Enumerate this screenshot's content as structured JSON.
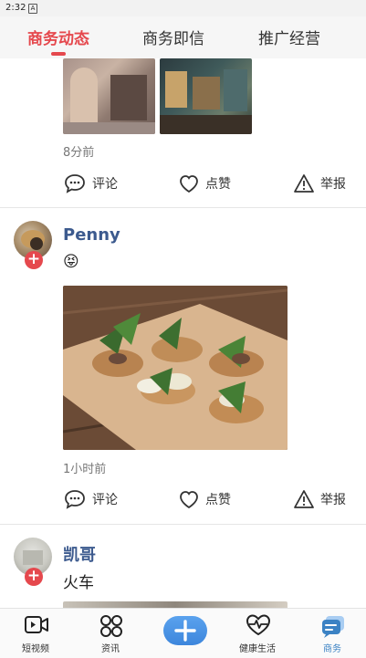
{
  "status_bar": {
    "time": "2:32",
    "notification_icon": "A"
  },
  "tabs": [
    {
      "label": "商务动态",
      "active": true
    },
    {
      "label": "商务即信",
      "active": false
    },
    {
      "label": "推广经营",
      "active": false
    }
  ],
  "posts": [
    {
      "time": "8分前",
      "actions": {
        "comment": "评论",
        "like": "点赞",
        "report": "举报"
      }
    },
    {
      "username": "Penny",
      "text": "😝",
      "time": "1小时前",
      "actions": {
        "comment": "评论",
        "like": "点赞",
        "report": "举报"
      }
    },
    {
      "username": "凯哥",
      "text": "火车"
    }
  ],
  "bottom_nav": [
    {
      "label": "短视频",
      "icon": "video-icon"
    },
    {
      "label": "资讯",
      "icon": "grid-icon"
    },
    {
      "label": "",
      "icon": "plus-icon"
    },
    {
      "label": "健康生活",
      "icon": "heart-pulse-icon"
    },
    {
      "label": "商务",
      "icon": "chat-icon",
      "active": true
    }
  ],
  "colors": {
    "accent": "#e5484d",
    "username": "#3c5a8e",
    "nav_active": "#3b82c4"
  }
}
